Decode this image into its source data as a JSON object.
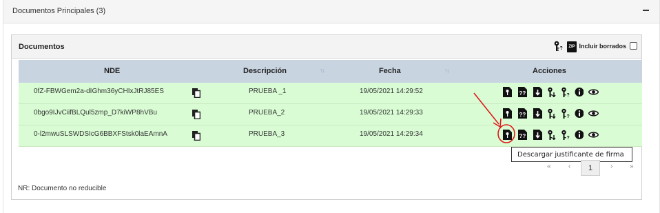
{
  "panel": {
    "title": "Documentos Principales (3)"
  },
  "section": {
    "title": "Documentos",
    "include_deleted_label": "Incluir borrados",
    "zip_label": "ZIP"
  },
  "table": {
    "headers": {
      "nde": "NDE",
      "descripcion": "Descripción",
      "fecha": "Fecha",
      "acciones": "Acciones"
    },
    "sort_icon": "↑↓",
    "rows": [
      {
        "nde": "0fZ-FBWGem2a-dIGhm36yCHIxJtRJ85ES",
        "descripcion": "PRUEBA _1",
        "fecha": "19/05/2021 14:29:52"
      },
      {
        "nde": "0bgo9IJvCiifBLQul5zmp_D7kiWP8hVBu",
        "descripcion": "PRUEBA_2",
        "fecha": "19/05/2021 14:29:33"
      },
      {
        "nde": "0-l2mwuSLSWDSIcG6BBXFStsk0laEAmnA",
        "descripcion": "PRUEBA_3",
        "fecha": "19/05/2021 14:29:34"
      }
    ]
  },
  "tooltip": {
    "text": "Descargar justificante de firma"
  },
  "pagination": {
    "first": "«",
    "prev": "‹",
    "current": "1",
    "next": "›",
    "last": "»"
  },
  "footnote": "NR: Documento no reducible",
  "colors": {
    "row_bg": "#d9fcd4",
    "header_bg": "#c9d4e1",
    "annotation": "#e0191b"
  }
}
